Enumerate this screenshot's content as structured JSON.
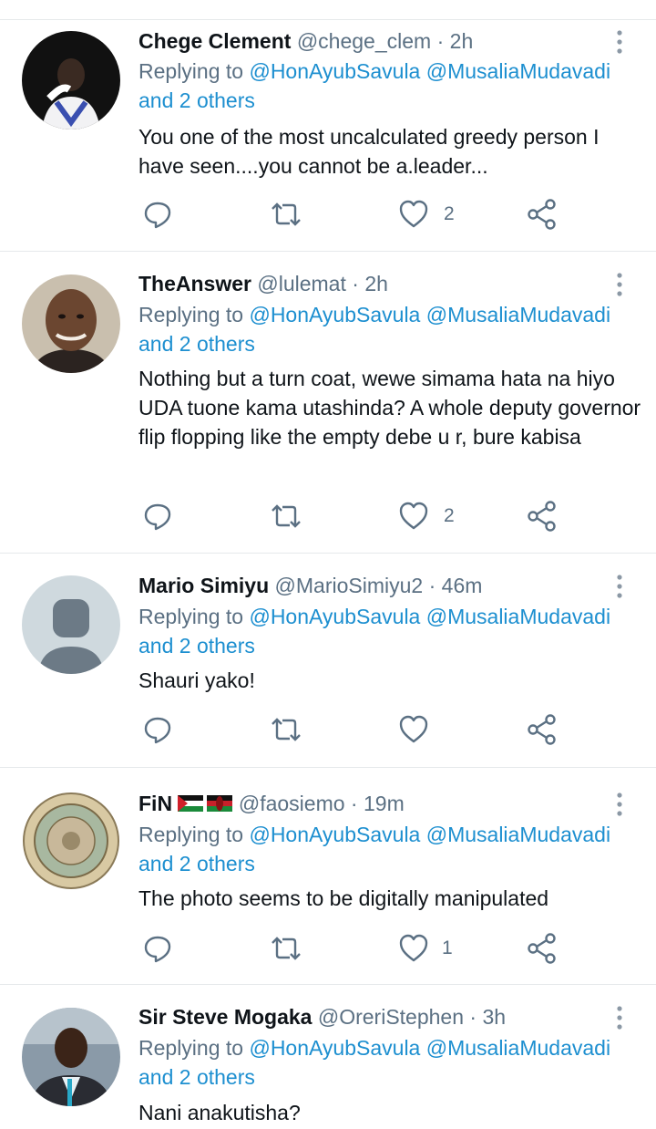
{
  "replying_prefix": "Replying to",
  "tweets": [
    {
      "name": "Chege Clement",
      "handle": "@chege_clem",
      "time": "2h",
      "mention1": "@HonAyubSavula",
      "mention2": "@MusaliaMudavadi",
      "others": "and 2 others",
      "text": "You one of the most uncalculated greedy person I have seen....you cannot be a.leader...",
      "likes": "2"
    },
    {
      "name": "TheAnswer",
      "handle": "@lulemat",
      "time": "2h",
      "mention1": "@HonAyubSavula",
      "mention2": "@MusaliaMudavadi",
      "others": "and 2 others",
      "text": "Nothing but a turn coat, wewe simama hata na hiyo UDA tuone kama utashinda? A whole deputy governor flip flopping like the empty debe u r, bure kabisa",
      "likes": "2"
    },
    {
      "name": "Mario Simiyu",
      "handle": "@MarioSimiyu2",
      "time": "46m",
      "mention1": "@HonAyubSavula",
      "mention2": "@MusaliaMudavadi",
      "others": "and 2 others",
      "text": "Shauri yako!",
      "likes": ""
    },
    {
      "name": "FiN",
      "handle": "@faosiemo",
      "time": "19m",
      "mention1": "@HonAyubSavula",
      "mention2": "@MusaliaMudavadi",
      "others": "and 2 others",
      "text": "The photo seems to be digitally manipulated",
      "likes": "1"
    },
    {
      "name": "Sir Steve Mogaka",
      "handle": "@OreriStephen",
      "time": "3h",
      "mention1": "@HonAyubSavula",
      "mention2": "@MusaliaMudavadi",
      "others": "and 2 others",
      "text": "Nani anakutisha?",
      "likes": ""
    }
  ],
  "dot": "·",
  "icons": [
    "reply-icon",
    "retweet-icon",
    "like-icon",
    "share-icon",
    "more-icon"
  ],
  "colors": {
    "mention": "#1d8fd0",
    "secondary": "#5b7083",
    "divider": "#e6e9eb"
  }
}
